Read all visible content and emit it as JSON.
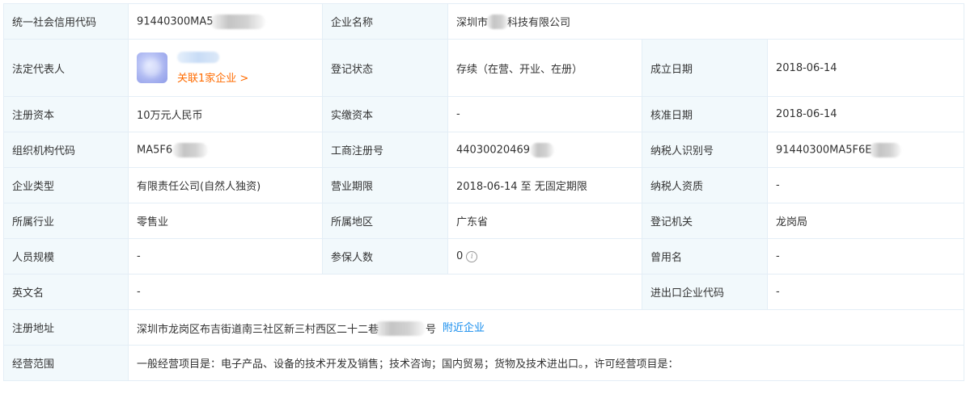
{
  "rows": {
    "credit_code": {
      "label": "统一社会信用代码",
      "value": "91440300MA5"
    },
    "company_name": {
      "label": "企业名称",
      "value_prefix": "深圳市",
      "value_suffix": "科技有限公司"
    },
    "legal_rep": {
      "label": "法定代表人",
      "link": "关联1家企业 >"
    },
    "reg_status": {
      "label": "登记状态",
      "value": "存续（在营、开业、在册）"
    },
    "found_date": {
      "label": "成立日期",
      "value": "2018-06-14"
    },
    "reg_capital": {
      "label": "注册资本",
      "value": "10万元人民币"
    },
    "paid_capital": {
      "label": "实缴资本",
      "value": "-"
    },
    "approve_date": {
      "label": "核准日期",
      "value": "2018-06-14"
    },
    "org_code": {
      "label": "组织机构代码",
      "value": "MA5F6"
    },
    "biz_reg_no": {
      "label": "工商注册号",
      "value": "44030020469"
    },
    "taxpayer_id": {
      "label": "纳税人识别号",
      "value": "91440300MA5F6E"
    },
    "company_type": {
      "label": "企业类型",
      "value": "有限责任公司(自然人独资)"
    },
    "biz_term": {
      "label": "营业期限",
      "value": "2018-06-14 至 无固定期限"
    },
    "taxpayer_qual": {
      "label": "纳税人资质",
      "value": "-"
    },
    "industry": {
      "label": "所属行业",
      "value": "零售业"
    },
    "region": {
      "label": "所属地区",
      "value": "广东省"
    },
    "reg_authority": {
      "label": "登记机关",
      "value": "龙岗局"
    },
    "staff_size": {
      "label": "人员规模",
      "value": "-"
    },
    "insured_count": {
      "label": "参保人数",
      "value": "0"
    },
    "former_name": {
      "label": "曾用名",
      "value": "-"
    },
    "english_name": {
      "label": "英文名",
      "value": "-"
    },
    "import_export_code": {
      "label": "进出口企业代码",
      "value": "-"
    },
    "reg_address": {
      "label": "注册地址",
      "value": "深圳市龙岗区布吉街道南三社区新三村西区二十二巷",
      "value_end": "号",
      "link": "附近企业"
    },
    "biz_scope": {
      "label": "经营范围",
      "value": "一般经营项目是：电子产品、设备的技术开发及销售；技术咨询；国内贸易；货物及技术进出口。，许可经营项目是："
    }
  },
  "colors": {
    "label_bg": "#f2f9fc",
    "border": "#e4eef6",
    "link_orange": "#ff6b00",
    "link_blue": "#128bed"
  },
  "icons": {
    "info": "info-icon"
  }
}
